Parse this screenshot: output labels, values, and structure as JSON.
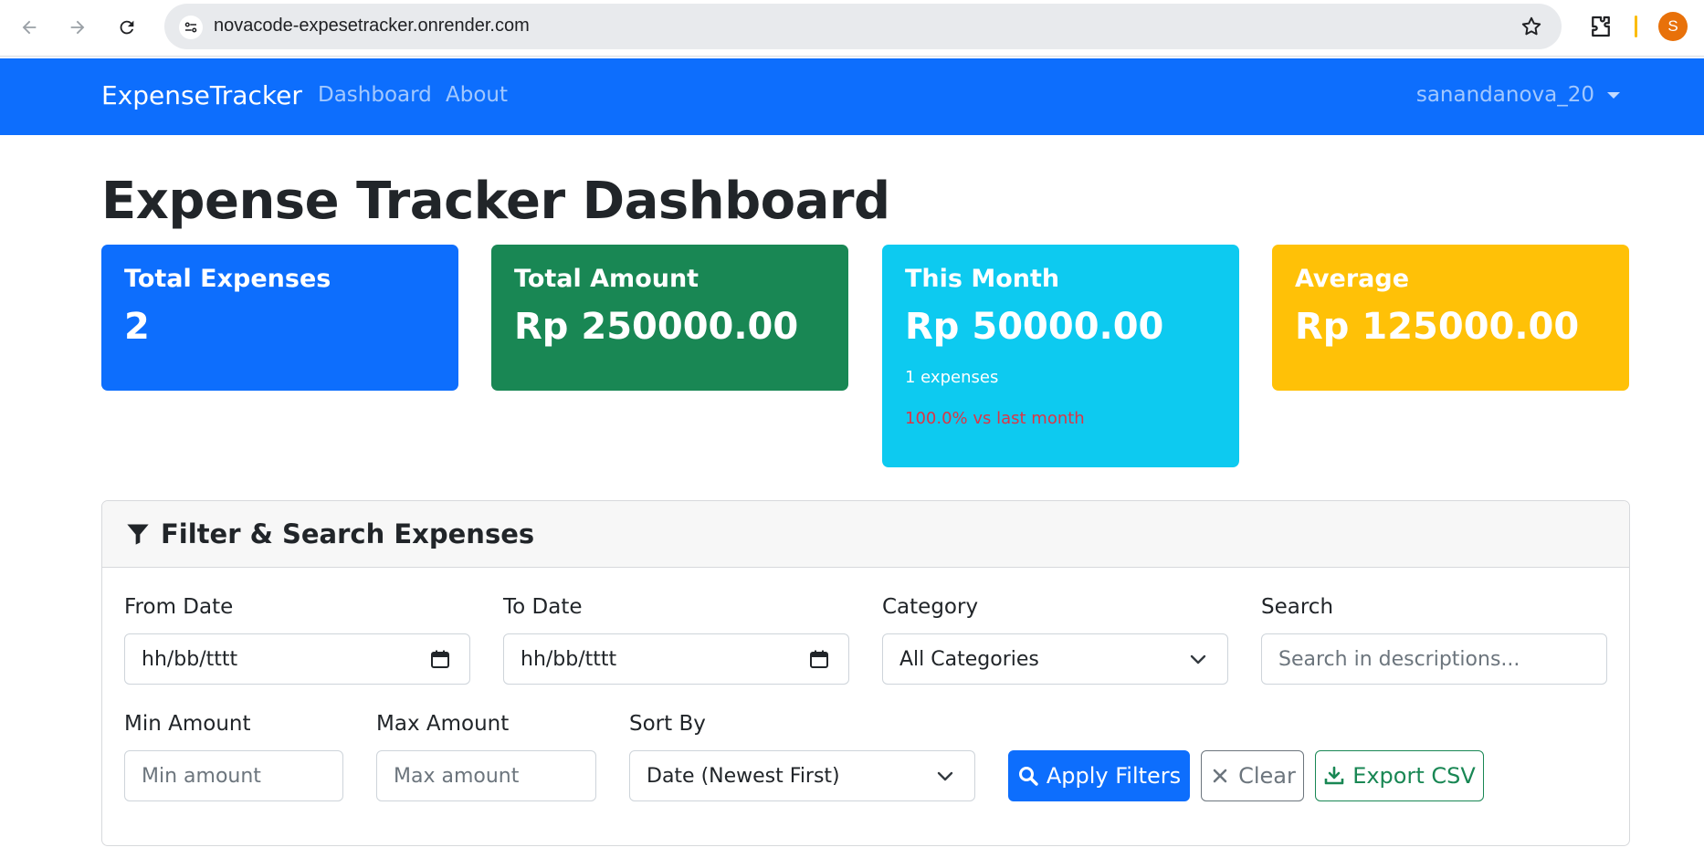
{
  "browser": {
    "url": "novacode-expesetracker.onrender.com",
    "profile_initial": "S"
  },
  "navbar": {
    "brand": "ExpenseTracker",
    "links": [
      "Dashboard",
      "About"
    ],
    "user": "sanandanova_20"
  },
  "page": {
    "title": "Expense Tracker Dashboard"
  },
  "cards": {
    "total_expenses": {
      "title": "Total Expenses",
      "value": "2",
      "color": "#0d6efd"
    },
    "total_amount": {
      "title": "Total Amount",
      "value": "Rp 250000.00",
      "color": "#198754"
    },
    "this_month": {
      "title": "This Month",
      "value": "Rp 50000.00",
      "sub": "1 expenses",
      "trend": "100.0% vs last month",
      "color": "#0dcaf0"
    },
    "average": {
      "title": "Average",
      "value": "Rp 125000.00",
      "color": "#ffc107"
    }
  },
  "filters": {
    "header": "Filter & Search Expenses",
    "from_date": {
      "label": "From Date",
      "value": "hh/bb/tttt"
    },
    "to_date": {
      "label": "To Date",
      "value": "hh/bb/tttt"
    },
    "category": {
      "label": "Category",
      "value": "All Categories"
    },
    "search": {
      "label": "Search",
      "placeholder": "Search in descriptions..."
    },
    "min_amount": {
      "label": "Min Amount",
      "placeholder": "Min amount"
    },
    "max_amount": {
      "label": "Max Amount",
      "placeholder": "Max amount"
    },
    "sort_by": {
      "label": "Sort By",
      "value": "Date (Newest First)"
    },
    "buttons": {
      "apply": "Apply Filters",
      "clear": "Clear",
      "export": "Export CSV"
    }
  }
}
